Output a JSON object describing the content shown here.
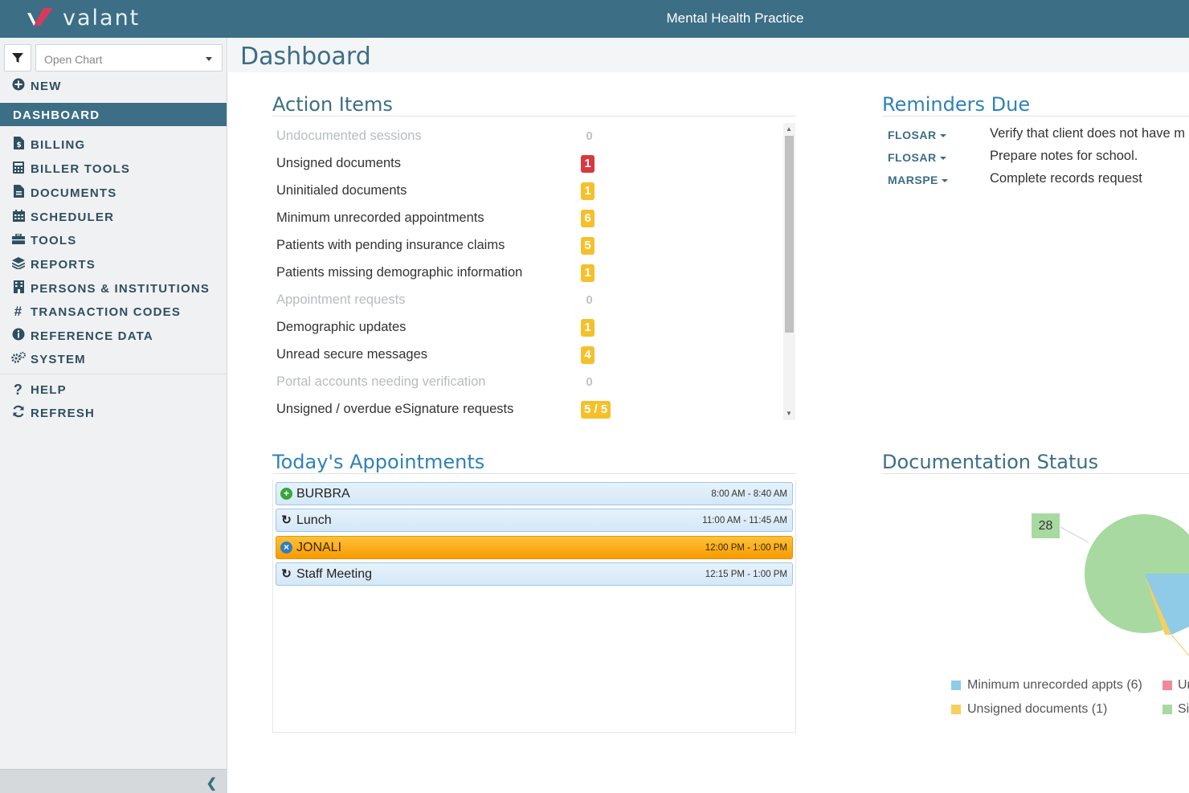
{
  "header": {
    "logo_text": "valant",
    "practice_name": "Mental Health Practice"
  },
  "sidebar": {
    "open_chart_placeholder": "Open Chart",
    "new_label": "NEW",
    "active_label": "DASHBOARD",
    "items": [
      {
        "label": "BILLING",
        "icon": "file-dollar-icon"
      },
      {
        "label": "BILLER TOOLS",
        "icon": "calculator-icon"
      },
      {
        "label": "DOCUMENTS",
        "icon": "document-icon"
      },
      {
        "label": "SCHEDULER",
        "icon": "calendar-icon"
      },
      {
        "label": "TOOLS",
        "icon": "toolbox-icon"
      },
      {
        "label": "REPORTS",
        "icon": "layers-icon"
      },
      {
        "label": "PERSONS & INSTITUTIONS",
        "icon": "building-icon"
      },
      {
        "label": "TRANSACTION CODES",
        "icon": "hash-icon"
      },
      {
        "label": "REFERENCE DATA",
        "icon": "info-icon"
      },
      {
        "label": "SYSTEM",
        "icon": "gears-icon"
      }
    ],
    "help_label": "HELP",
    "refresh_label": "REFRESH"
  },
  "page": {
    "title": "Dashboard"
  },
  "action_items": {
    "title": "Action Items",
    "rows": [
      {
        "label": "Undocumented sessions",
        "count": "0",
        "style": "zero"
      },
      {
        "label": "Unsigned documents",
        "count": "1",
        "style": "red"
      },
      {
        "label": "Uninitialed documents",
        "count": "1",
        "style": "yellow"
      },
      {
        "label": "Minimum unrecorded appointments",
        "count": "6",
        "style": "yellow"
      },
      {
        "label": "Patients with pending insurance claims",
        "count": "5",
        "style": "yellow"
      },
      {
        "label": "Patients missing demographic information",
        "count": "1",
        "style": "yellow"
      },
      {
        "label": "Appointment requests",
        "count": "0",
        "style": "zero"
      },
      {
        "label": "Demographic updates",
        "count": "1",
        "style": "yellow"
      },
      {
        "label": "Unread secure messages",
        "count": "4",
        "style": "yellow"
      },
      {
        "label": "Portal accounts needing verification",
        "count": "0",
        "style": "zero"
      },
      {
        "label": "Unsigned / overdue eSignature requests",
        "count": "5 / 5",
        "style": "yellow"
      }
    ]
  },
  "reminders": {
    "title": "Reminders Due",
    "items": [
      {
        "who": "FLOSAR",
        "text": "Verify that client does not have m"
      },
      {
        "who": "FLOSAR",
        "text": "Prepare notes for school."
      },
      {
        "who": "MARSPE",
        "text": "Complete records request"
      }
    ]
  },
  "appointments": {
    "title": "Today's Appointments",
    "items": [
      {
        "name": "BURBRA",
        "time": "8:00 AM - 8:40 AM",
        "icon": "plus-circle-icon",
        "active": false
      },
      {
        "name": "Lunch",
        "time": "11:00 AM - 11:45 AM",
        "icon": "recurring-icon",
        "active": false
      },
      {
        "name": "JONALI",
        "time": "12:00 PM - 1:00 PM",
        "icon": "cancel-circle-icon",
        "active": true
      },
      {
        "name": "Staff Meeting",
        "time": "12:15 PM - 1:00 PM",
        "icon": "recurring-icon",
        "active": false
      }
    ]
  },
  "documentation_status": {
    "title": "Documentation Status",
    "pie_callout": "28",
    "legend": [
      {
        "label": "Minimum unrecorded appts (6)",
        "color": "#8fcbe6"
      },
      {
        "label": "Un",
        "color": "#f08a9a"
      },
      {
        "label": "Unsigned documents (1)",
        "color": "#f7cf5c"
      },
      {
        "label": "Si",
        "color": "#a8d9a0"
      }
    ]
  }
}
